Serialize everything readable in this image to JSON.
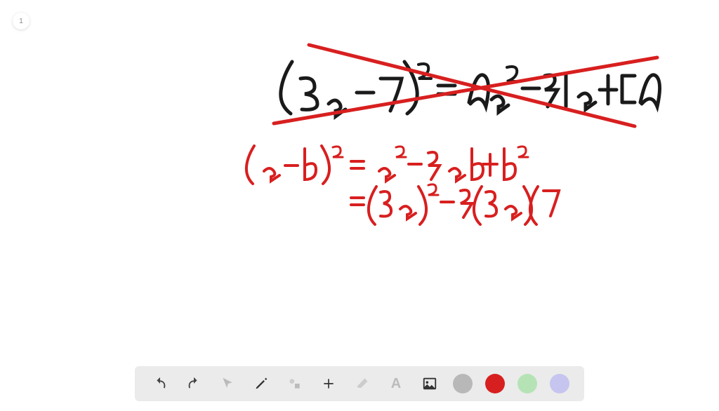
{
  "page_number": "1",
  "handwriting": {
    "line1_black": "(3a − 7)² = 9a² − 21a + 49",
    "line2_red": "(a − b)² = a² − 2ab + b²",
    "line3_red": "= (3a)² − 2(3a)(7"
  },
  "toolbar": {
    "undo": "↶",
    "redo": "↷",
    "pointer": "pointer",
    "pen": "pen",
    "shapes": "shapes",
    "plus": "+",
    "eraser": "eraser",
    "text": "A",
    "image": "image"
  },
  "colors": {
    "gray": "#b8b8b8",
    "red": "#d81f1f",
    "lightgreen": "#b6e3b6",
    "lightpurple": "#c5c5ef"
  }
}
